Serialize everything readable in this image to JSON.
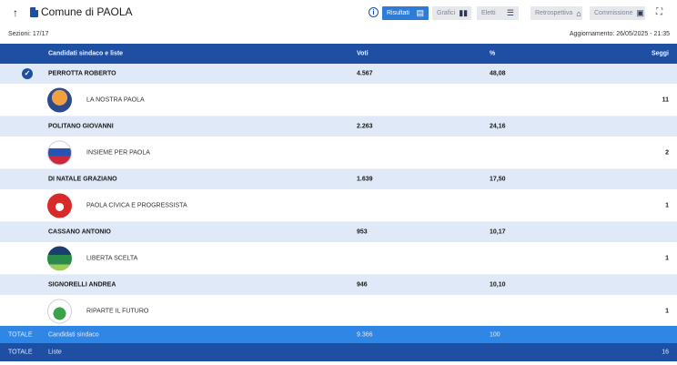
{
  "header": {
    "title": "Comune di PAOLA",
    "tabs": [
      {
        "label": "Risultati",
        "icon": "table-icon",
        "active": true
      },
      {
        "label": "Grafici",
        "icon": "bar-chart-icon",
        "active": false
      },
      {
        "label": "Eletti",
        "icon": "list-icon",
        "active": false
      },
      {
        "label": "Retrospettiva",
        "icon": "institution-icon",
        "active": false
      },
      {
        "label": "Commissione",
        "icon": "video-icon",
        "active": false
      }
    ]
  },
  "subbar": {
    "sections": "Sezioni: 17/17",
    "updated": "Aggiornamento: 26/05/2025 - 21:35"
  },
  "table": {
    "headers": {
      "name": "Candidati sindaco e liste",
      "votes": "Voti",
      "pct": "%",
      "seats": "Seggi"
    },
    "candidates": [
      {
        "name": "PERROTTA ROBERTO",
        "votes": "4.567",
        "pct": "48,08",
        "elected": true,
        "list": {
          "name": "LA NOSTRA PAOLA",
          "seats": "11",
          "logo_colors": [
            "#e0802a",
            "#2d4a8a"
          ]
        }
      },
      {
        "name": "POLITANO GIOVANNI",
        "votes": "2.263",
        "pct": "24,16",
        "elected": false,
        "list": {
          "name": "INSIEME PER PAOLA",
          "seats": "2",
          "logo_colors": [
            "#2753b5",
            "#d0263a"
          ]
        }
      },
      {
        "name": "DI NATALE GRAZIANO",
        "votes": "1.639",
        "pct": "17,50",
        "elected": false,
        "list": {
          "name": "PAOLA CIVICA E PROGRESSISTA",
          "seats": "1",
          "logo_colors": [
            "#d92a2a",
            "#ffffff"
          ]
        }
      },
      {
        "name": "CASSANO ANTONIO",
        "votes": "953",
        "pct": "10,17",
        "elected": false,
        "list": {
          "name": "LIBERTA SCELTA",
          "seats": "1",
          "logo_colors": [
            "#2a8a4a",
            "#1c3e6e"
          ]
        }
      },
      {
        "name": "SIGNORELLI ANDREA",
        "votes": "946",
        "pct": "10,10",
        "elected": false,
        "list": {
          "name": "RIPARTE IL FUTURO",
          "seats": "1",
          "logo_colors": [
            "#3aa34a",
            "#ffffff"
          ]
        }
      }
    ],
    "totals": [
      {
        "label": "TOTALE",
        "sub": "Candidati sindaco",
        "votes": "9.366",
        "pct": "100",
        "seats": ""
      },
      {
        "label": "TOTALE",
        "sub": "Liste",
        "votes": "",
        "pct": "",
        "seats": "16"
      }
    ]
  }
}
